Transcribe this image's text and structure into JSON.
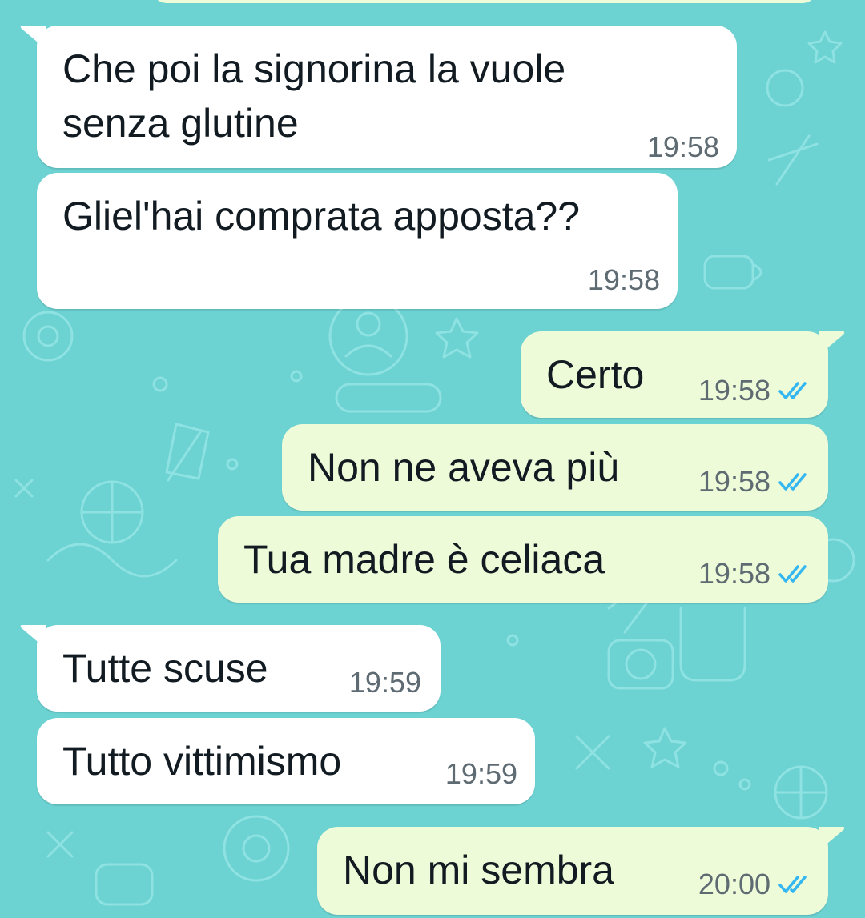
{
  "colors": {
    "wallpaper": "#6dd2d2",
    "incoming_bubble": "#ffffff",
    "outgoing_bubble": "#eefbd9",
    "read_ticks": "#34b7f1"
  },
  "messages": [
    {
      "direction": "incoming",
      "lines": [
        "Che poi la signorina la vuole",
        "senza glutine"
      ],
      "time": "19:58"
    },
    {
      "direction": "incoming",
      "lines": [
        "Gliel'hai comprata apposta??"
      ],
      "time": "19:58"
    },
    {
      "direction": "outgoing",
      "lines": [
        "Certo"
      ],
      "time": "19:58",
      "status_icon": "double-check-read-icon"
    },
    {
      "direction": "outgoing",
      "lines": [
        "Non ne aveva più"
      ],
      "time": "19:58",
      "status_icon": "double-check-read-icon"
    },
    {
      "direction": "outgoing",
      "lines": [
        "Tua madre è celiaca"
      ],
      "time": "19:58",
      "status_icon": "double-check-read-icon"
    },
    {
      "direction": "incoming",
      "lines": [
        "Tutte scuse"
      ],
      "time": "19:59"
    },
    {
      "direction": "incoming",
      "lines": [
        "Tutto vittimismo"
      ],
      "time": "19:59"
    },
    {
      "direction": "outgoing",
      "lines": [
        "Non mi sembra"
      ],
      "time": "20:00",
      "status_icon": "double-check-read-icon"
    }
  ]
}
